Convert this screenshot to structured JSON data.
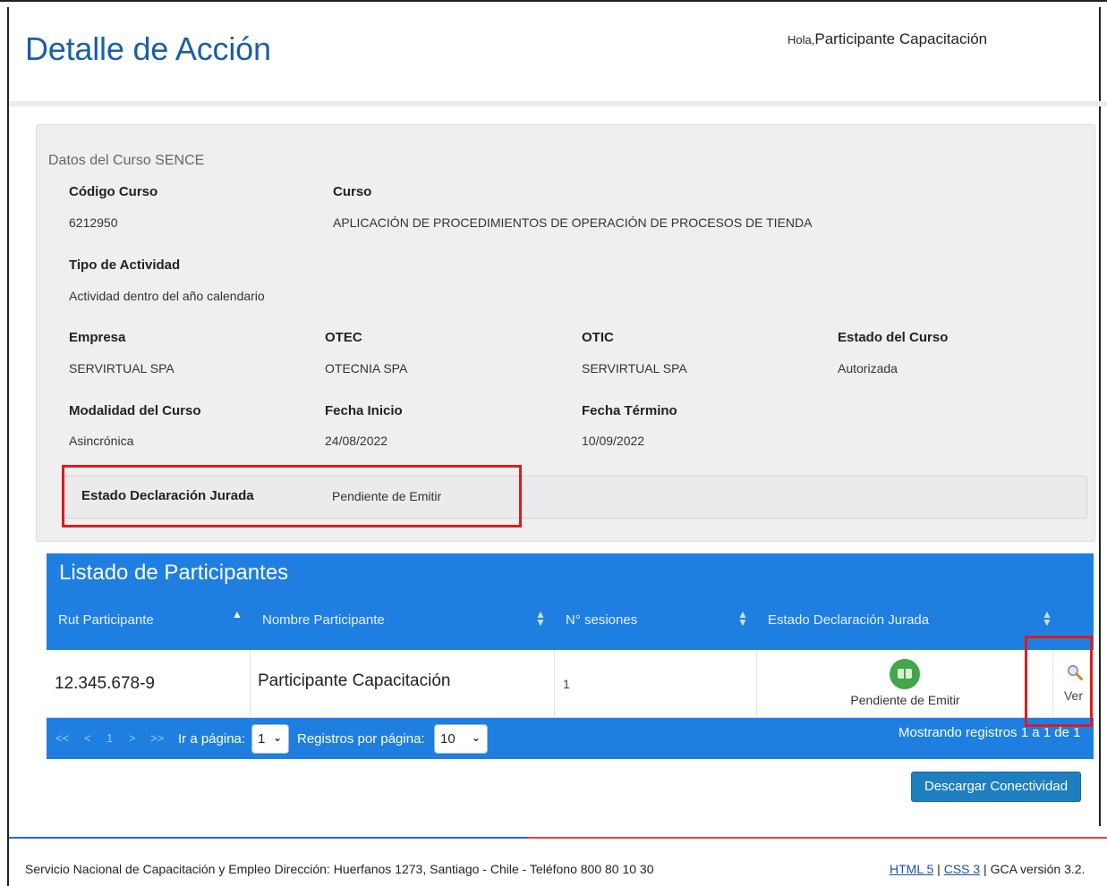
{
  "header": {
    "title": "Detalle de Acción",
    "greeting_prefix": "Hola,",
    "user_name": "Participante Capacitación"
  },
  "course": {
    "section_title": "Datos del Curso SENCE",
    "codigo_label": "Código Curso",
    "codigo_value": "6212950",
    "curso_label": "Curso",
    "curso_value": "APLICACIÓN DE PROCEDIMIENTOS DE OPERACIÓN DE PROCESOS DE TIENDA",
    "tipo_label": "Tipo de Actividad",
    "tipo_value": "Actividad dentro del año calendario",
    "empresa_label": "Empresa",
    "empresa_value": "SERVIRTUAL SPA",
    "otec_label": "OTEC",
    "otec_value": "OTECNIA SPA",
    "otic_label": "OTIC",
    "otic_value": "SERVIRTUAL SPA",
    "estado_label": "Estado del Curso",
    "estado_value": "Autorizada",
    "modalidad_label": "Modalidad del Curso",
    "modalidad_value": "Asincrónica",
    "inicio_label": "Fecha Inicio",
    "inicio_value": "24/08/2022",
    "termino_label": "Fecha Término",
    "termino_value": "10/09/2022",
    "dj_label": "Estado Declaración Jurada",
    "dj_value": "Pendiente de Emitir"
  },
  "participants": {
    "title": "Listado de Participantes",
    "columns": [
      "Rut Participante",
      "Nombre Participante",
      "N° sesiones",
      "Estado Declaración Jurada"
    ],
    "rows": [
      {
        "rut": "12.345.678-9",
        "nombre": "Participante Capacitación",
        "sesiones": "1",
        "estado": "Pendiente de Emitir",
        "estado_icon": "book-icon",
        "action_icon": "magnifier-icon",
        "action_label": "Ver"
      }
    ],
    "pager": {
      "first": "<<",
      "prev": "<",
      "page": "1",
      "next": ">",
      "last": ">>",
      "goto_label": "Ir a página:",
      "goto_value": "1",
      "per_page_label": "Registros por página:",
      "per_page_value": "10",
      "showing": "Mostrando registros 1 a 1 de 1"
    }
  },
  "actions": {
    "download_label": "Descargar Conectividad"
  },
  "footer": {
    "text": "Servicio Nacional de Capacitación y Empleo Dirección: Huerfanos 1273, Santiago - Chile - Teléfono 800 80 10 30",
    "html5": "HTML 5",
    "sep1": " | ",
    "css3": "CSS 3",
    "sep2": " | ",
    "version": "GCA versión 3.2."
  },
  "colors": {
    "title_blue": "#1b5fa6",
    "table_blue": "#1e7fe0",
    "highlight_red": "#e01b1b",
    "status_green": "#43a64a"
  }
}
